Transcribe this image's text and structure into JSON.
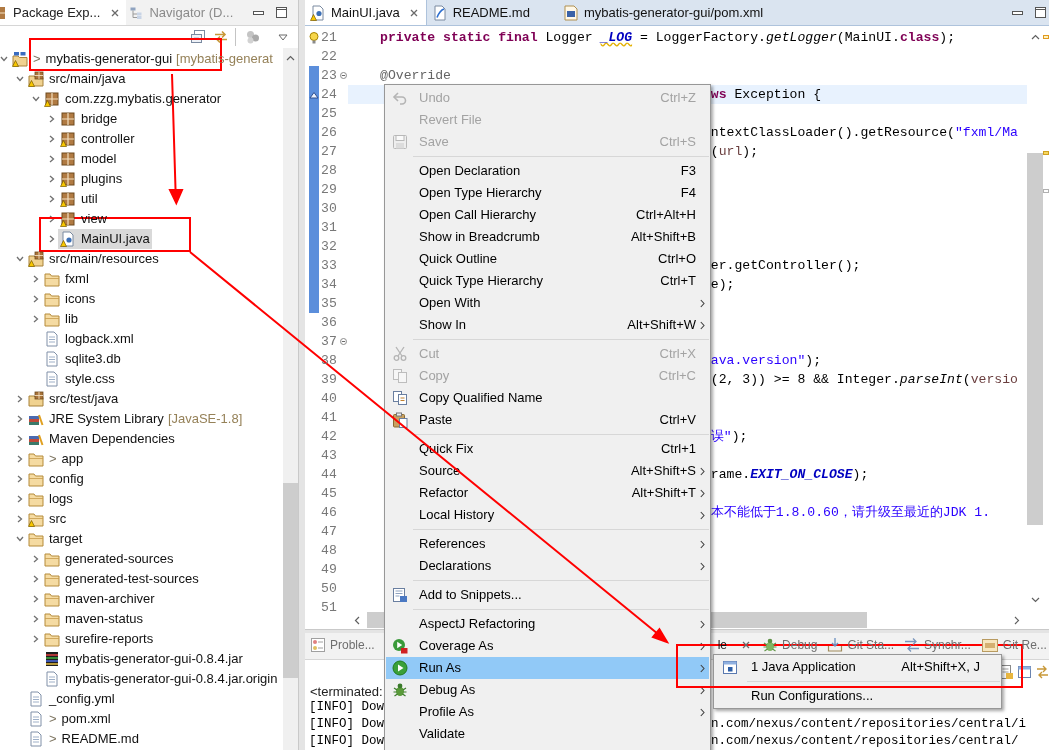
{
  "package_explorer": {
    "tabs": [
      {
        "label": "Package Exp...",
        "selected": true
      },
      {
        "label": "Navigator (D...",
        "selected": false
      }
    ],
    "tree": [
      {
        "label": "mybatis-generator-gui",
        "prefix": ">",
        "suffix": "[mybatis-generat",
        "kind": "project",
        "expanded": true,
        "warning": true,
        "selected": false,
        "children": [
          {
            "label": "src/main/java",
            "kind": "source-folder",
            "expanded": true,
            "warning": true,
            "selected": false,
            "children": [
              {
                "label": "com.zzg.mybatis.generator",
                "kind": "package",
                "expanded": true,
                "warning": true,
                "selected": false,
                "children": [
                  {
                    "label": "bridge",
                    "kind": "package",
                    "expanded": false,
                    "warning": false,
                    "selected": false
                  },
                  {
                    "label": "controller",
                    "kind": "package",
                    "expanded": false,
                    "warning": true,
                    "selected": false
                  },
                  {
                    "label": "model",
                    "kind": "package",
                    "expanded": false,
                    "warning": false,
                    "selected": false
                  },
                  {
                    "label": "plugins",
                    "kind": "package",
                    "expanded": false,
                    "warning": true,
                    "selected": false
                  },
                  {
                    "label": "util",
                    "kind": "package",
                    "expanded": false,
                    "warning": true,
                    "selected": false
                  },
                  {
                    "label": "view",
                    "kind": "package",
                    "expanded": false,
                    "warning": true,
                    "selected": false
                  },
                  {
                    "label": "MainUI.java",
                    "kind": "java",
                    "expanded": false,
                    "warning": true,
                    "selected": true
                  }
                ]
              }
            ]
          },
          {
            "label": "src/main/resources",
            "kind": "source-folder",
            "expanded": true,
            "warning": true,
            "selected": false,
            "children": [
              {
                "label": "fxml",
                "kind": "folder",
                "expanded": false,
                "warning": false,
                "selected": false
              },
              {
                "label": "icons",
                "kind": "folder",
                "expanded": false,
                "warning": false,
                "selected": false
              },
              {
                "label": "lib",
                "kind": "folder",
                "expanded": false,
                "warning": false,
                "selected": false
              },
              {
                "label": "logback.xml",
                "kind": "file",
                "warning": false,
                "selected": false
              },
              {
                "label": "sqlite3.db",
                "kind": "file",
                "warning": false,
                "selected": false
              },
              {
                "label": "style.css",
                "kind": "file",
                "warning": false,
                "selected": false
              }
            ]
          },
          {
            "label": "src/test/java",
            "kind": "source-folder",
            "expanded": false,
            "warning": false,
            "selected": false
          },
          {
            "label": "JRE System Library",
            "suffix": "[JavaSE-1.8]",
            "kind": "library",
            "expanded": false,
            "warning": false,
            "selected": false
          },
          {
            "label": "Maven Dependencies",
            "kind": "library",
            "expanded": false,
            "warning": false,
            "selected": false
          },
          {
            "label": "app",
            "prefix": ">",
            "kind": "folder",
            "expanded": false,
            "warning": false,
            "selected": false
          },
          {
            "label": "config",
            "kind": "folder",
            "expanded": false,
            "warning": false,
            "selected": false
          },
          {
            "label": "logs",
            "kind": "folder",
            "expanded": false,
            "warning": false,
            "selected": false
          },
          {
            "label": "src",
            "kind": "folder",
            "expanded": false,
            "warning": true,
            "selected": false
          },
          {
            "label": "target",
            "kind": "folder",
            "expanded": true,
            "warning": false,
            "selected": false,
            "children": [
              {
                "label": "generated-sources",
                "kind": "folder",
                "expanded": false,
                "warning": false,
                "selected": false
              },
              {
                "label": "generated-test-sources",
                "kind": "folder",
                "expanded": false,
                "warning": false,
                "selected": false
              },
              {
                "label": "maven-archiver",
                "kind": "folder",
                "expanded": false,
                "warning": false,
                "selected": false
              },
              {
                "label": "maven-status",
                "kind": "folder",
                "expanded": false,
                "warning": false,
                "selected": false
              },
              {
                "label": "surefire-reports",
                "kind": "folder",
                "expanded": false,
                "warning": false,
                "selected": false
              },
              {
                "label": "mybatis-generator-gui-0.8.4.jar",
                "kind": "archive",
                "warning": false,
                "selected": false
              },
              {
                "label": "mybatis-generator-gui-0.8.4.jar.origin",
                "kind": "file",
                "warning": false,
                "selected": false
              }
            ]
          },
          {
            "label": "_config.yml",
            "kind": "file",
            "warning": false,
            "selected": false
          },
          {
            "label": "pom.xml",
            "prefix": ">",
            "kind": "file",
            "warning": false,
            "selected": false
          },
          {
            "label": "README.md",
            "prefix": ">",
            "kind": "file",
            "warning": false,
            "selected": false
          }
        ]
      }
    ]
  },
  "editor": {
    "tabs": [
      {
        "label": "MainUI.java",
        "kind": "java",
        "selected": true
      },
      {
        "label": "README.md",
        "kind": "markdown",
        "selected": false
      },
      {
        "label": "mybatis-generator-gui/pom.xml",
        "kind": "maven",
        "selected": false
      }
    ],
    "blocks": [
      {
        "in_range": false,
        "lines": [
          {
            "number": "21",
            "current": false,
            "marker": {
              "kind": "warning"
            },
            "tokens": [
              {
                "text": "private static final",
                "kind": "keyword"
              },
              {
                "text": " Logger ",
                "kind": "plain"
              },
              {
                "text": "_LOG",
                "kind": "warned-field"
              },
              {
                "text": " = LoggerFactory.",
                "kind": "plain"
              },
              {
                "text": "getLogger",
                "kind": "static-method"
              },
              {
                "text": "(MainUI.",
                "kind": "plain"
              },
              {
                "text": "class",
                "kind": "keyword"
              },
              {
                "text": ");",
                "kind": "plain"
              }
            ]
          },
          {
            "number": "22",
            "current": false
          }
        ]
      },
      {
        "in_range": true,
        "lines": [
          {
            "number": "23",
            "current": false,
            "fold_marker": {
              "kind": "collapse"
            },
            "tokens": [
              {
                "text": "@Override",
                "kind": "annotation"
              }
            ]
          },
          {
            "number": "24",
            "current": true,
            "marker": {
              "kind": "override"
            },
            "after_menu": [
              {
                "text": "ws",
                "kind": "keyword"
              },
              {
                "text": " Exception {",
                "kind": "plain"
              }
            ]
          },
          {
            "number": "25",
            "current": false
          },
          {
            "number": "26",
            "current": false,
            "after_menu": [
              {
                "text": "ntextClassLoader().getResource(",
                "kind": "plain"
              },
              {
                "text": "\"fxml/Ma",
                "kind": "string"
              }
            ]
          },
          {
            "number": "27",
            "current": false,
            "after_menu": [
              {
                "text": "(",
                "kind": "plain"
              },
              {
                "text": "url",
                "kind": "local"
              },
              {
                "text": ");",
                "kind": "plain"
              }
            ]
          },
          {
            "number": "28",
            "current": false
          },
          {
            "number": "29",
            "current": false
          },
          {
            "number": "30",
            "current": false
          },
          {
            "number": "31",
            "current": false
          },
          {
            "number": "32",
            "current": false
          },
          {
            "number": "33",
            "current": false,
            "after_menu": [
              {
                "text": "er.getController();",
                "kind": "plain"
              }
            ]
          },
          {
            "number": "34",
            "current": false,
            "after_menu": [
              {
                "text": "e);",
                "kind": "plain"
              }
            ]
          },
          {
            "number": "35",
            "current": false
          }
        ]
      },
      {
        "in_range": false,
        "lines": [
          {
            "number": "36",
            "current": false
          },
          {
            "number": "37",
            "current": false,
            "fold_marker": {
              "kind": "collapse"
            }
          },
          {
            "number": "38",
            "current": false,
            "after_menu": [
              {
                "text": "ava.version\"",
                "kind": "string"
              },
              {
                "text": ");",
                "kind": "plain"
              }
            ]
          },
          {
            "number": "39",
            "current": false,
            "after_menu": [
              {
                "text": "(2, 3)) >= 8 && Integer.",
                "kind": "plain"
              },
              {
                "text": "parseInt",
                "kind": "static-method"
              },
              {
                "text": "(",
                "kind": "plain"
              },
              {
                "text": "versio",
                "kind": "local"
              }
            ]
          },
          {
            "number": "40",
            "current": false
          },
          {
            "number": "41",
            "current": false
          },
          {
            "number": "42",
            "current": false,
            "after_menu": [
              {
                "text": "误\"",
                "kind": "string"
              },
              {
                "text": ");",
                "kind": "plain"
              }
            ]
          },
          {
            "number": "43",
            "current": false
          },
          {
            "number": "44",
            "current": false,
            "after_menu": [
              {
                "text": "rame.",
                "kind": "plain"
              },
              {
                "text": "EXIT_ON_CLOSE",
                "kind": "static-field"
              },
              {
                "text": ");",
                "kind": "plain"
              }
            ]
          },
          {
            "number": "45",
            "current": false
          },
          {
            "number": "46",
            "current": false,
            "after_menu": [
              {
                "text": "本不能低于1.8.0.60，请升级至最近的JDK 1.",
                "kind": "string"
              }
            ]
          },
          {
            "number": "47",
            "current": false
          },
          {
            "number": "48",
            "current": false
          },
          {
            "number": "49",
            "current": false
          },
          {
            "number": "50",
            "current": false
          },
          {
            "number": "51",
            "current": false
          }
        ]
      }
    ]
  },
  "bottom_panel": {
    "tabs": [
      {
        "label": "Proble...",
        "kind": "problems",
        "selected": false
      },
      {
        "label": "le",
        "selected": true
      },
      {
        "label": "Debug",
        "kind": "debug",
        "selected": false
      },
      {
        "label": "Git Sta...",
        "kind": "git-staging",
        "selected": false
      },
      {
        "label": "Synchr...",
        "kind": "synchronize",
        "selected": false
      },
      {
        "label": "Git Re...",
        "kind": "git-repositories",
        "selected": false
      }
    ],
    "status": "<terminated:",
    "console_lines": [
      {
        "text": "[INFO] Dow"
      },
      {
        "text": "[INFO] Dow",
        "after_menu": "n.com/nexus/content/repositories/central/i"
      },
      {
        "text": "[INFO] Dow",
        "after_menu": "n.com/nexus/content/repositories/central/"
      }
    ]
  },
  "context_menu": {
    "groups": [
      [
        {
          "label": "Undo",
          "shortcut": "Ctrl+Z",
          "disabled": true,
          "has_submenu": false,
          "selected": false
        },
        {
          "label": "Revert File",
          "disabled": true,
          "has_submenu": false,
          "selected": false
        },
        {
          "label": "Save",
          "shortcut": "Ctrl+S",
          "disabled": true,
          "has_submenu": false,
          "selected": false
        }
      ],
      [
        {
          "label": "Open Declaration",
          "shortcut": "F3",
          "disabled": false,
          "has_submenu": false,
          "selected": false
        },
        {
          "label": "Open Type Hierarchy",
          "shortcut": "F4",
          "disabled": false,
          "has_submenu": false,
          "selected": false
        },
        {
          "label": "Open Call Hierarchy",
          "shortcut": "Ctrl+Alt+H",
          "disabled": false,
          "has_submenu": false,
          "selected": false
        },
        {
          "label": "Show in Breadcrumb",
          "shortcut": "Alt+Shift+B",
          "disabled": false,
          "has_submenu": false,
          "selected": false
        },
        {
          "label": "Quick Outline",
          "shortcut": "Ctrl+O",
          "disabled": false,
          "has_submenu": false,
          "selected": false
        },
        {
          "label": "Quick Type Hierarchy",
          "shortcut": "Ctrl+T",
          "disabled": false,
          "has_submenu": false,
          "selected": false
        },
        {
          "label": "Open With",
          "disabled": false,
          "has_submenu": true,
          "selected": false
        },
        {
          "label": "Show In",
          "shortcut": "Alt+Shift+W",
          "disabled": false,
          "has_submenu": true,
          "selected": false
        }
      ],
      [
        {
          "label": "Cut",
          "shortcut": "Ctrl+X",
          "disabled": true,
          "has_submenu": false,
          "selected": false
        },
        {
          "label": "Copy",
          "shortcut": "Ctrl+C",
          "disabled": true,
          "has_submenu": false,
          "selected": false
        },
        {
          "label": "Copy Qualified Name",
          "disabled": false,
          "has_submenu": false,
          "selected": false
        },
        {
          "label": "Paste",
          "shortcut": "Ctrl+V",
          "disabled": false,
          "has_submenu": false,
          "selected": false
        }
      ],
      [
        {
          "label": "Quick Fix",
          "shortcut": "Ctrl+1",
          "disabled": false,
          "has_submenu": false,
          "selected": false
        },
        {
          "label": "Source",
          "shortcut": "Alt+Shift+S",
          "disabled": false,
          "has_submenu": true,
          "selected": false
        },
        {
          "label": "Refactor",
          "shortcut": "Alt+Shift+T",
          "disabled": false,
          "has_submenu": true,
          "selected": false
        },
        {
          "label": "Local History",
          "disabled": false,
          "has_submenu": true,
          "selected": false
        }
      ],
      [
        {
          "label": "References",
          "disabled": false,
          "has_submenu": true,
          "selected": false
        },
        {
          "label": "Declarations",
          "disabled": false,
          "has_submenu": true,
          "selected": false
        }
      ],
      [
        {
          "label": "Add to Snippets...",
          "disabled": false,
          "has_submenu": false,
          "selected": false
        }
      ],
      [
        {
          "label": "AspectJ Refactoring",
          "disabled": false,
          "has_submenu": true,
          "selected": false
        },
        {
          "label": "Coverage As",
          "disabled": false,
          "has_submenu": true,
          "selected": false
        },
        {
          "label": "Run As",
          "disabled": false,
          "has_submenu": true,
          "selected": true
        },
        {
          "label": "Debug As",
          "disabled": false,
          "has_submenu": true,
          "selected": false
        },
        {
          "label": "Profile As",
          "disabled": false,
          "has_submenu": true,
          "selected": false
        },
        {
          "label": "Validate",
          "disabled": false,
          "has_submenu": false,
          "selected": false
        }
      ]
    ]
  },
  "run_as_submenu": {
    "groups": [
      [
        {
          "label": "1 Java Application",
          "shortcut": "Alt+Shift+X, J",
          "selected": false
        }
      ],
      [
        {
          "label": "Run Configurations...",
          "selected": false
        }
      ]
    ]
  }
}
